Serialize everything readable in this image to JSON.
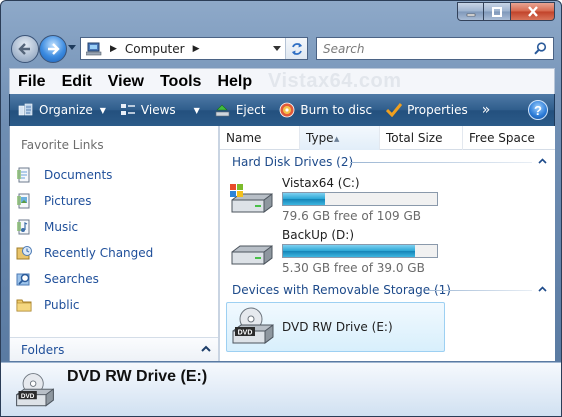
{
  "window": {
    "caption": {
      "minimize": "minimize",
      "maximize": "maximize",
      "close": "close"
    }
  },
  "address": {
    "crumbs": [
      "Computer"
    ],
    "search_placeholder": "Search"
  },
  "menu": {
    "items": [
      "File",
      "Edit",
      "View",
      "Tools",
      "Help"
    ],
    "watermark": "Vistax64.com"
  },
  "toolbar": {
    "organize": "Organize",
    "views": "Views",
    "eject": "Eject",
    "burn": "Burn to disc",
    "properties": "Properties",
    "more": "»",
    "help": "?"
  },
  "navigation": {
    "section_title": "Favorite Links",
    "links": [
      {
        "label": "Documents",
        "icon": "documents-icon"
      },
      {
        "label": "Pictures",
        "icon": "pictures-icon"
      },
      {
        "label": "Music",
        "icon": "music-icon"
      },
      {
        "label": "Recently Changed",
        "icon": "recently-changed-icon"
      },
      {
        "label": "Searches",
        "icon": "searches-icon"
      },
      {
        "label": "Public",
        "icon": "public-folder-icon"
      }
    ],
    "folders_label": "Folders"
  },
  "columns": [
    "Name",
    "Type",
    "Total Size",
    "Free Space"
  ],
  "groups": {
    "hard_disks": {
      "title": "Hard Disk Drives (2)",
      "drives": [
        {
          "name": "Vistax64 (C:)",
          "free_text": "79.6 GB free of 109 GB",
          "used_fraction": 0.27
        },
        {
          "name": "BackUp (D:)",
          "free_text": "5.30 GB free of 39.0 GB",
          "used_fraction": 0.86
        }
      ]
    },
    "removable": {
      "title": "Devices with Removable Storage (1)",
      "drives": [
        {
          "name": "DVD RW Drive (E:)",
          "icon_label": "DVD"
        }
      ]
    }
  },
  "details": {
    "title": "DVD RW Drive (E:)",
    "icon_label": "DVD"
  },
  "colors": {
    "link": "#1f4f9a",
    "group_header": "#1d4a8a",
    "command_bar": "#2f5d8c",
    "progress": "#2aa6d5"
  }
}
